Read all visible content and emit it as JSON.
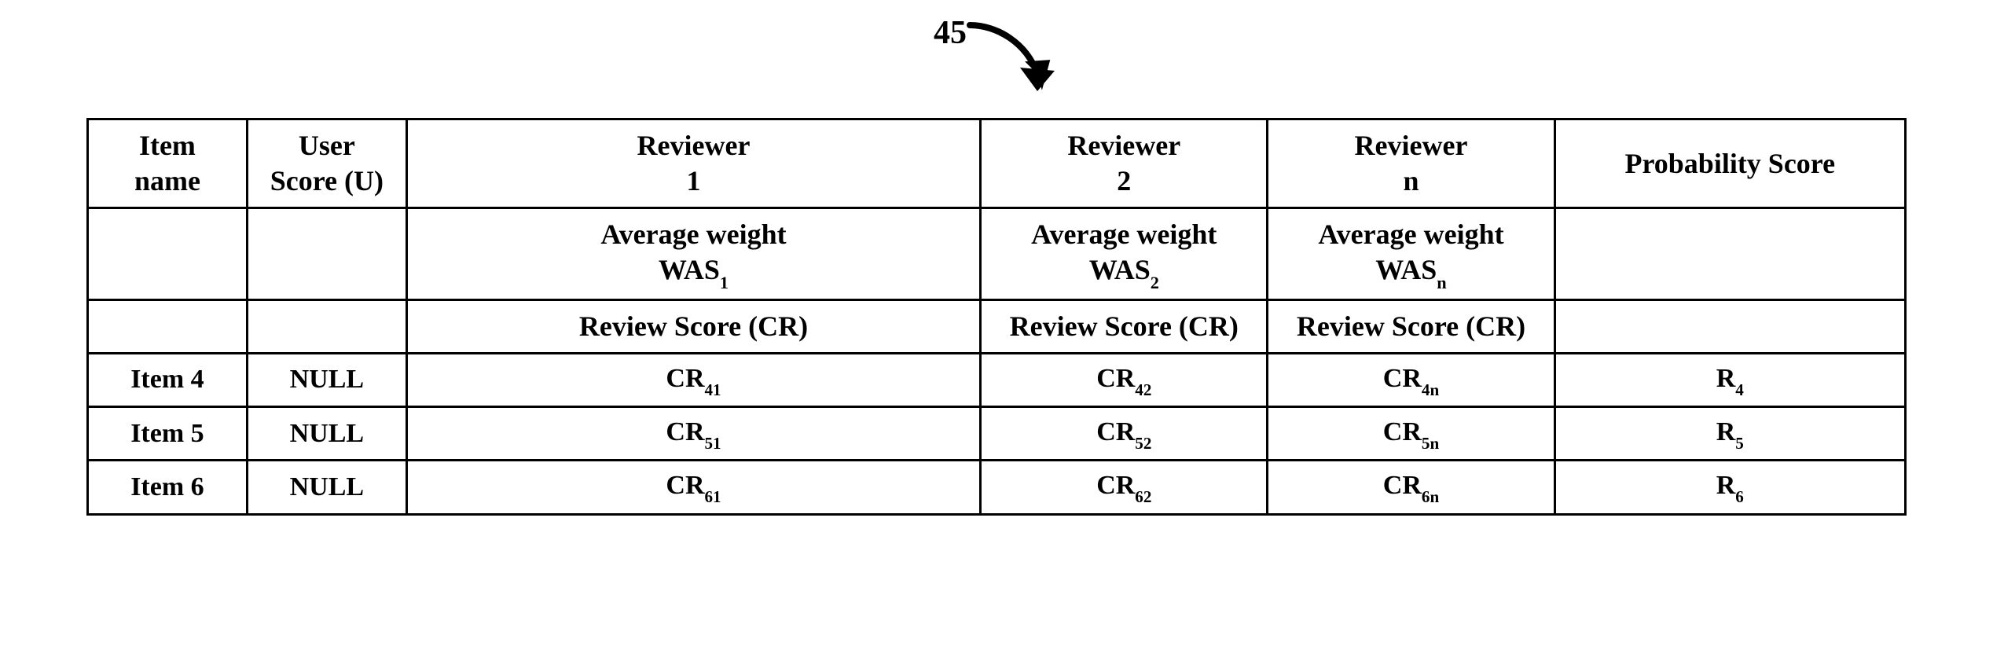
{
  "figure": {
    "number": "45"
  },
  "headers": {
    "item": "Item\nname",
    "user": "User\nScore (U)",
    "reviewer1": "Reviewer\n1",
    "reviewer2": "Reviewer\n2",
    "reviewern": "Reviewer\nn",
    "prob": "Probability Score"
  },
  "subheaders": {
    "avg_prefix": "Average weight\nWAS",
    "avg1_sub": "1",
    "avg2_sub": "2",
    "avgn_sub": "n",
    "review_score": "Review Score (CR)"
  },
  "rows": [
    {
      "item": "Item 4",
      "user": "NULL",
      "cr_prefix": "CR",
      "cr1_sub": "41",
      "cr2_sub": "42",
      "crn_sub": "4n",
      "r_prefix": "R",
      "r_sub": "4"
    },
    {
      "item": "Item 5",
      "user": "NULL",
      "cr_prefix": "CR",
      "cr1_sub": "51",
      "cr2_sub": "52",
      "crn_sub": "5n",
      "r_prefix": "R",
      "r_sub": "5"
    },
    {
      "item": "Item 6",
      "user": "NULL",
      "cr_prefix": "CR",
      "cr1_sub": "61",
      "cr2_sub": "62",
      "crn_sub": "6n",
      "r_prefix": "R",
      "r_sub": "6"
    }
  ]
}
